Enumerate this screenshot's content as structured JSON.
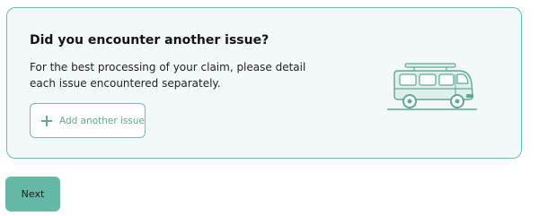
{
  "card": {
    "title": "Did you encounter another issue?",
    "description": "For the best processing of your claim, please detail each issue encountered separately.",
    "add_button_label": "Add another issue",
    "illustration": "camper-van-icon"
  },
  "footer": {
    "next_label": "Next"
  },
  "colors": {
    "accent": "#66b8a6",
    "border": "#6dbfa6",
    "card_bg": "#f3f9fa",
    "van_fill": "#dff0ec",
    "van_stroke": "#5fa893"
  }
}
